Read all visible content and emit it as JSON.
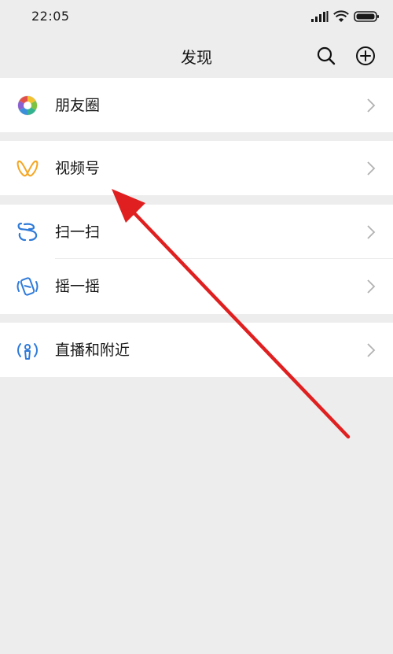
{
  "status_bar": {
    "time": "22:05"
  },
  "nav": {
    "title": "发现",
    "search_icon": "search-icon",
    "add_icon": "plus-circle-icon"
  },
  "cells": {
    "moments": {
      "label": "朋友圈",
      "icon": "moments-aperture-icon"
    },
    "channels": {
      "label": "视频号",
      "icon": "channels-butterfly-icon"
    },
    "scan": {
      "label": "扫一扫",
      "icon": "scan-icon"
    },
    "shake": {
      "label": "摇一摇",
      "icon": "shake-icon"
    },
    "live_nearby": {
      "label": "直播和附近",
      "icon": "live-nearby-icon"
    }
  },
  "colors": {
    "background": "#ededed",
    "cell_background": "#ffffff",
    "channels_accent": "#f5a623",
    "scan_blue": "#2f7bd9",
    "annotation_red": "#e02020"
  }
}
